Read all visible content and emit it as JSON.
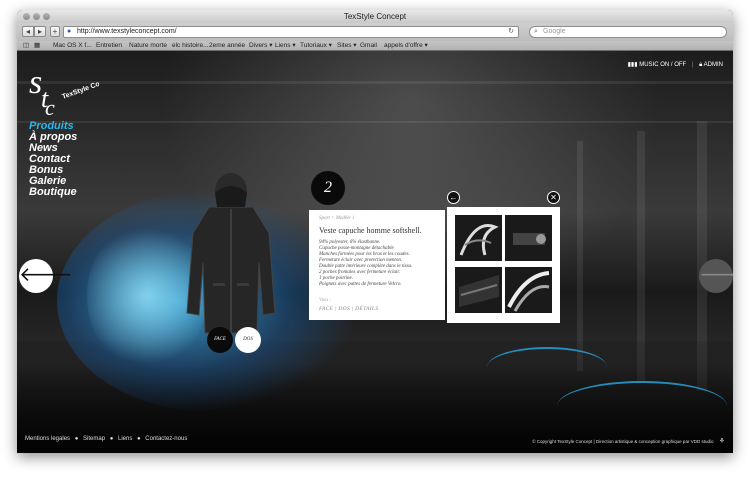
{
  "browser": {
    "window_title": "TexStyle Concept",
    "url": "http://www.texstyleconcept.com/",
    "search_placeholder": "Google",
    "bookmarks": [
      "Mac OS X f...",
      "Entretien",
      "Nature morte",
      "elc histoire...",
      "2eme année",
      "Divers ▾",
      "Liens ▾",
      "Tutoriaux ▾",
      "Sites ▾",
      "Gmail",
      "appels d'offre ▾"
    ]
  },
  "site": {
    "logo_text": "TexStyle Concept",
    "menu": [
      "Produits",
      "À propos",
      "News",
      "Contact",
      "Bonus",
      "Galerie",
      "Boutique"
    ],
    "music_toggle": "MUSIC ON / OFF",
    "admin": "ADMIN"
  },
  "product": {
    "slide_number": "2",
    "breadcrumb": "Sport > Modèle 1",
    "title": "Veste capuche homme softshell.",
    "description_lines": [
      "94% polyester, 6% élasthanne.",
      "Capuche posse-montagne détachable",
      "Manches formées pour les bras et les coudes.",
      "Fermeture éclair avec protection menton.",
      "Double patte intérieure complète dans le tissu.",
      "2 poches frontales avec fermeture éclair.",
      "1 poche poitrine.",
      "Poignets avec pattes de fermeture Velcro."
    ],
    "views_label": "Vues :",
    "views_links": "FACE | DOS | DÉTAILS",
    "face_label": "FACE",
    "back_label": "DOS"
  },
  "footer": {
    "links": [
      "Mentions legales",
      "Sitemap",
      "Liens",
      "Contactez-nous"
    ],
    "copyright": "© Copyright TexStyle Concept | Direction artistique & conception graphique par VDD studio"
  }
}
